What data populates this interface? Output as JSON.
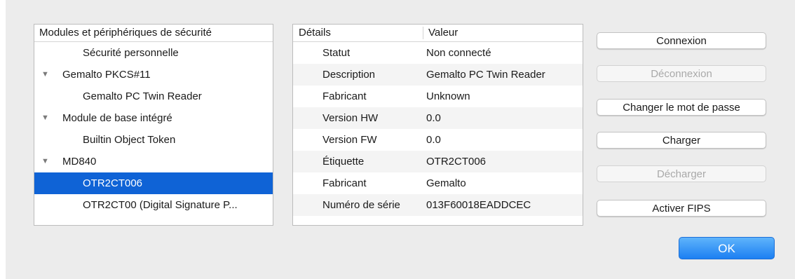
{
  "tree": {
    "header": "Modules et périphériques de sécurité",
    "rows": [
      {
        "label": "Sécurité personnelle",
        "level": "child"
      },
      {
        "label": "Gemalto PKCS#11",
        "level": "parent"
      },
      {
        "label": "Gemalto PC Twin Reader",
        "level": "child"
      },
      {
        "label": "Module de base intégré",
        "level": "parent"
      },
      {
        "label": "Builtin Object Token",
        "level": "child"
      },
      {
        "label": "MD840",
        "level": "parent"
      },
      {
        "label": "OTR2CT006",
        "level": "child",
        "selected": true
      },
      {
        "label": "OTR2CT00 (Digital Signature P...",
        "level": "child"
      }
    ],
    "disclosure_glyph": "▼"
  },
  "details": {
    "col_detail": "Détails",
    "col_value": "Valeur",
    "rows": [
      {
        "key": "Statut",
        "value": "Non connecté"
      },
      {
        "key": "Description",
        "value": "Gemalto PC Twin Reader"
      },
      {
        "key": "Fabricant",
        "value": "Unknown"
      },
      {
        "key": "Version HW",
        "value": "0.0"
      },
      {
        "key": "Version FW",
        "value": "0.0"
      },
      {
        "key": "Étiquette",
        "value": "OTR2CT006"
      },
      {
        "key": "Fabricant",
        "value": "Gemalto"
      },
      {
        "key": "Numéro de série",
        "value": "013F60018EADDCEC"
      }
    ]
  },
  "buttons": {
    "connect": "Connexion",
    "disconnect": "Déconnexion",
    "change_password": "Changer le mot de passe",
    "load": "Charger",
    "unload": "Décharger",
    "enable_fips": "Activer FIPS",
    "ok": "OK"
  },
  "colors": {
    "selection": "#0f63d6",
    "ok_button": "#1c7ff2",
    "disabled_text": "#a9a9a9"
  }
}
